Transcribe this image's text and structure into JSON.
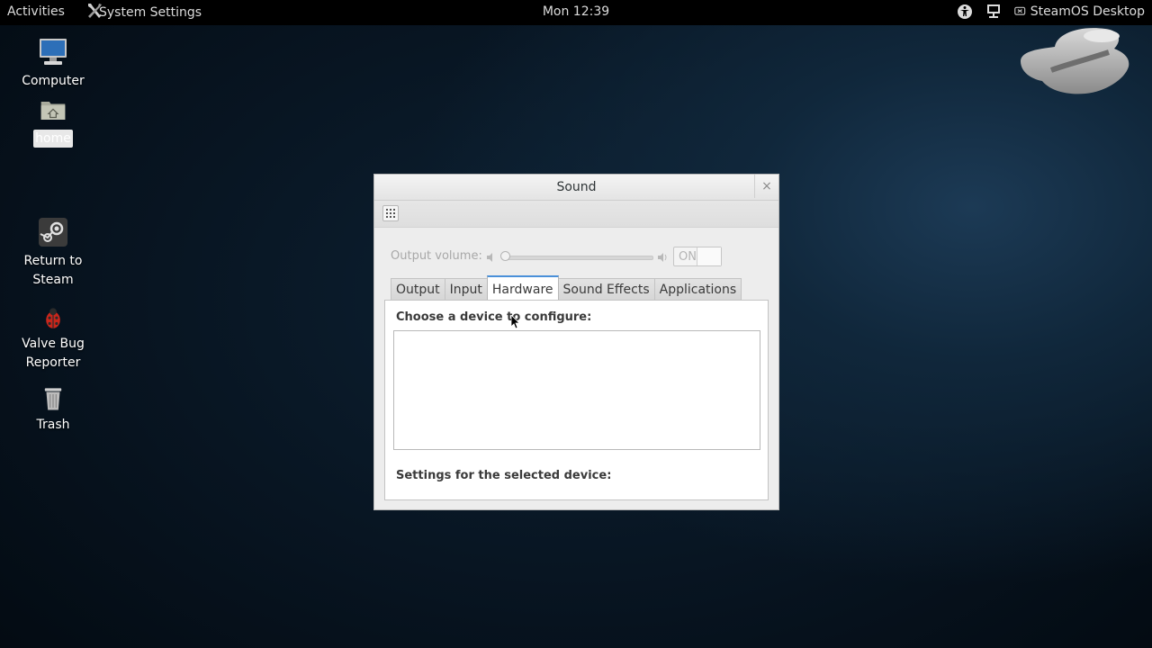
{
  "topbar": {
    "activities": "Activities",
    "app_menu": "System Settings",
    "clock": "Mon 12:39",
    "session": "SteamOS Desktop",
    "icons": [
      "accessibility-icon",
      "network-icon",
      "session-icon"
    ]
  },
  "desktop": {
    "icons": [
      {
        "label": "Computer",
        "icon": "computer-icon"
      },
      {
        "label": "home",
        "icon": "home-folder-icon"
      },
      {
        "label": "Return to Steam",
        "icon": "steam-icon"
      },
      {
        "label": "Valve Bug Reporter",
        "icon": "bug-icon"
      },
      {
        "label": "Trash",
        "icon": "trash-icon"
      }
    ]
  },
  "window": {
    "title": "Sound",
    "close_glyph": "×",
    "output_volume_label": "Output volume:",
    "output_volume_value": 0,
    "toggle_label": "ON",
    "tabs": [
      "Output",
      "Input",
      "Hardware",
      "Sound Effects",
      "Applications"
    ],
    "active_tab": "Hardware",
    "choose_device_label": "Choose a device to configure:",
    "settings_label": "Settings for the selected device:"
  },
  "colors": {
    "accent": "#4a90d9",
    "topbar_bg": "#000000",
    "desktop_bg": "#07131f"
  }
}
